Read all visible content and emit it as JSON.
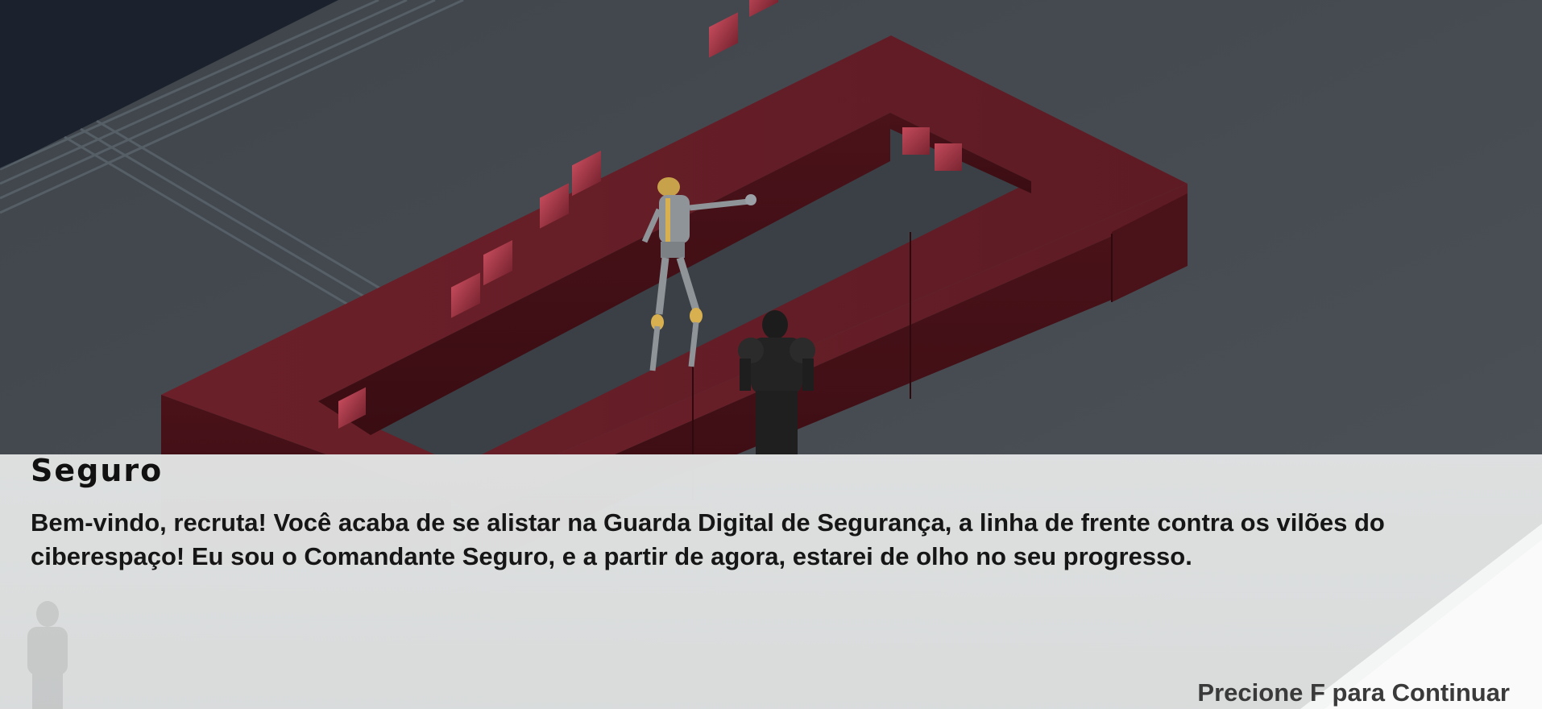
{
  "dialog": {
    "speaker": "Seguro",
    "message": "Bem-vindo, recruta! Você acaba de se alistar na Guarda Digital de Segurança, a linha de frente contra os vilões do ciberespaço! Eu sou o Comandante Seguro, e a partir de agora, estarei de olho no seu progresso.",
    "continue_hint": "Precione F para Continuar"
  },
  "scene": {
    "floor_color": "#4a5056",
    "desk_color": "#5a1a22",
    "sky_color": "#1c222d"
  }
}
